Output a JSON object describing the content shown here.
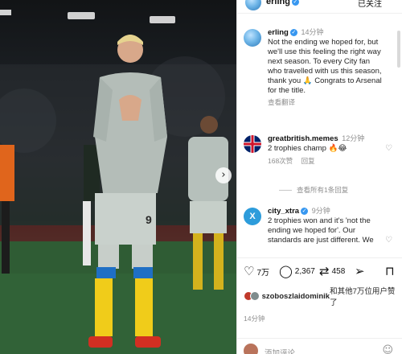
{
  "post": {
    "username": "erling",
    "follow_label": "已关注",
    "caption": {
      "username": "erling",
      "time": "14分钟",
      "text": "Not the ending we hoped for, but we'll use this feeling the right way next season. To every City fan who travelled with us this season, thank you 🙏 Congrats to Arsenal for the title.",
      "see_translation": "查看翻译"
    },
    "comments": [
      {
        "username": "greatbritish.memes",
        "time": "12分钟",
        "text": "2 trophies champ 🔥😂",
        "likes": "168次赞",
        "reply": "回复",
        "view_replies": "查看所有1条回复"
      },
      {
        "username": "city_xtra",
        "time": "9分钟",
        "text": "2 trophies won and it's 'not the ending we hoped for'. Our standards are just different. We"
      }
    ],
    "actions": {
      "likes_count": "7万",
      "comments_count": "2,367",
      "reposts_count": "458"
    },
    "liked_by": {
      "user": "szoboszlaidominik",
      "suffix": "和其他7万位用户赞了"
    },
    "timestamp": "14分钟",
    "composer_placeholder": "添加评论…"
  },
  "photo": {
    "player_number": "9"
  },
  "icons": {
    "verified": "verified-badge-icon",
    "heart": "heart-icon",
    "comment": "comment-icon",
    "repost": "repost-icon",
    "share": "share-icon",
    "save": "bookmark-icon",
    "emoji": "emoji-icon",
    "carousel_next": "chevron-right-icon"
  },
  "colors": {
    "accent_blue": "#3797f0",
    "text_primary": "#262626",
    "text_secondary": "#8e8e8e"
  }
}
